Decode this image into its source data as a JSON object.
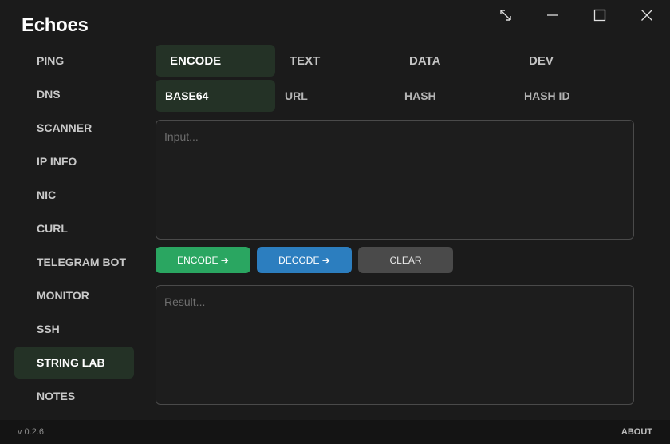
{
  "app": {
    "title": "Echoes",
    "version": "v 0.2.6",
    "about_label": "ABOUT"
  },
  "window_controls": {
    "icons": [
      "expand-icon",
      "minimize-icon",
      "maximize-icon",
      "close-icon"
    ]
  },
  "sidebar": {
    "items": [
      {
        "label": "PING"
      },
      {
        "label": "DNS"
      },
      {
        "label": "SCANNER"
      },
      {
        "label": "IP INFO"
      },
      {
        "label": "NIC"
      },
      {
        "label": "CURL"
      },
      {
        "label": "TELEGRAM BOT"
      },
      {
        "label": "MONITOR"
      },
      {
        "label": "SSH"
      },
      {
        "label": "STRING LAB",
        "active": true
      },
      {
        "label": "NOTES"
      }
    ]
  },
  "main_tabs": [
    {
      "label": "ENCODE",
      "active": true
    },
    {
      "label": "TEXT"
    },
    {
      "label": "DATA"
    },
    {
      "label": "DEV"
    }
  ],
  "sub_tabs": [
    {
      "label": "BASE64",
      "active": true
    },
    {
      "label": "URL"
    },
    {
      "label": "HASH"
    },
    {
      "label": "HASH ID"
    }
  ],
  "input": {
    "placeholder": "Input...",
    "value": ""
  },
  "result": {
    "placeholder": "Result...",
    "value": ""
  },
  "actions": {
    "encode_label": "ENCODE ➔",
    "decode_label": "DECODE ➔",
    "clear_label": "CLEAR"
  },
  "colors": {
    "active_tab_bg": "#243226",
    "encode_button": "#2aa661",
    "decode_button": "#2c7ebf",
    "clear_button": "#4a4a4a"
  }
}
